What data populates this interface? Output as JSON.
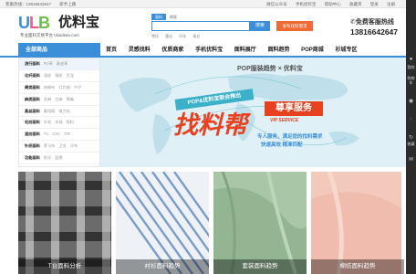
{
  "topbar": {
    "left": [
      "客服热线：13816642647",
      "新手上路"
    ],
    "right": [
      "微信公众号",
      "手机优料宝",
      "帮助中心",
      "收藏夹",
      "登录",
      "注册"
    ]
  },
  "logo": {
    "brand": "优料宝",
    "slogan": "专业面料交易平台 Uliaobao.com"
  },
  "search": {
    "tabs": [
      "面料",
      "商家"
    ],
    "placeholder": "",
    "button": "搜索",
    "publish": "发布找料需求",
    "hot": [
      "雪纺",
      "蕾丝",
      "印花",
      "真丝"
    ]
  },
  "hotline": {
    "title": "✆免费客服热线",
    "number": "13816642647"
  },
  "nav": {
    "all": "全部商品",
    "items": [
      "首页",
      "灵感找料",
      "优质商家",
      "手机优料宝",
      "面料展厅",
      "面料趋势",
      "POP商城",
      "衫城专区"
    ]
  },
  "sidebar": [
    {
      "cat": "流行面料",
      "tags": [
        "PU革",
        "真皮革"
      ]
    },
    {
      "cat": "化纤面料",
      "tags": [
        "涤纶",
        "锦纶",
        "尼龙"
      ]
    },
    {
      "cat": "棉类面料",
      "tags": [
        "府绸布",
        "灯芯绒",
        "牛仔"
      ]
    },
    {
      "cat": "麻类面料",
      "tags": [
        "亚麻",
        "苎麻",
        "棉麻"
      ]
    },
    {
      "cat": "真丝面料",
      "tags": [
        "素绉缎",
        "电力纺"
      ]
    },
    {
      "cat": "毛纺面料",
      "tags": [
        "羊毛",
        "羊绒",
        "呢料"
      ]
    },
    {
      "cat": "混纺面料",
      "tags": [
        "TC",
        "CVC",
        "T/R"
      ]
    },
    {
      "cat": "针织面料",
      "tags": [
        "罗马布",
        "卫衣",
        "汗布"
      ]
    },
    {
      "cat": "功能面料",
      "tags": [
        "防水",
        "阻燃"
      ]
    }
  ],
  "banner": {
    "brand": "POP服装趋势 × 优料宝",
    "ribbon": "POP&优料宝联合推出",
    "big": "找料帮",
    "badge": "尊享服务",
    "vip": "VIP SERVICE",
    "line1": "专人服务，满足您的找料需求",
    "line2": "快速高效  精准匹配"
  },
  "rightbar": {
    "labels": [
      "我的",
      "购物车",
      "收藏"
    ]
  },
  "tiles": [
    {
      "label": "T台面料分析"
    },
    {
      "label": "衬衫面料趋势"
    },
    {
      "label": "套装面料趋势"
    },
    {
      "label": "棉纺面料趋势"
    }
  ]
}
